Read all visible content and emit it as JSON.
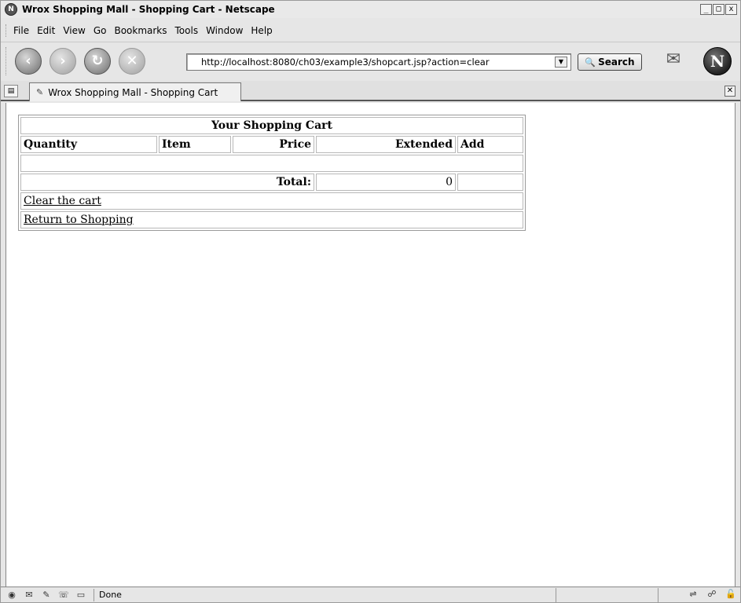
{
  "window": {
    "title": "Wrox Shopping Mall - Shopping Cart - Netscape",
    "app_icon": "netscape-icon",
    "controls": [
      "_",
      "□",
      "x"
    ]
  },
  "menubar": {
    "items": [
      {
        "label": "File"
      },
      {
        "label": "Edit"
      },
      {
        "label": "View"
      },
      {
        "label": "Go"
      },
      {
        "label": "Bookmarks"
      },
      {
        "label": "Tools"
      },
      {
        "label": "Window"
      },
      {
        "label": "Help"
      }
    ]
  },
  "navbar": {
    "buttons": [
      {
        "icon": "back-icon",
        "glyph": "‹"
      },
      {
        "icon": "forward-icon",
        "glyph": "›"
      },
      {
        "icon": "reload-icon",
        "glyph": "↻"
      },
      {
        "icon": "stop-icon",
        "glyph": "✕"
      }
    ],
    "url": "http://localhost:8080/ch03/example3/shopcart.jsp?action=clear",
    "search_label": "Search"
  },
  "tabs": [
    {
      "label": "Wrox Shopping Mall - Shopping Cart"
    }
  ],
  "cart": {
    "title": "Your Shopping Cart",
    "headers": {
      "quantity": "Quantity",
      "item": "Item",
      "price": "Price",
      "extended": "Extended",
      "add": "Add"
    },
    "total_label": "Total:",
    "total_value": "0",
    "clear_link": "Clear the cart",
    "return_link": "Return to Shopping"
  },
  "statusbar": {
    "text": "Done"
  }
}
